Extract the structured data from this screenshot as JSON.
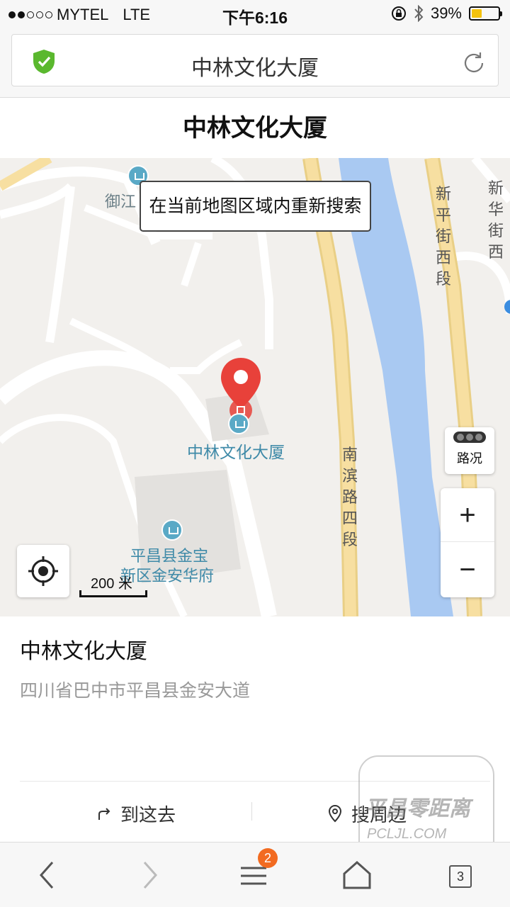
{
  "status": {
    "carrier": "MYTEL",
    "network": "LTE",
    "time": "下午6:16",
    "battery": "39%",
    "battery_level": 0.39
  },
  "browser": {
    "url_title": "中林文化大厦",
    "tab_count": "3",
    "menu_badge": "2"
  },
  "page": {
    "title": "中林文化大厦"
  },
  "map": {
    "research_button": "在当前地图区域内重新搜索",
    "poi_label": "中林文化大厦",
    "label_yujiang": "御江",
    "label_jinbao_1": "平昌县金宝",
    "label_jinbao_2": "新区金安华府",
    "road_nanbin": "南滨路四段",
    "road_xinping": "新平街西段",
    "road_xinhua": "新华街西",
    "traffic_label": "路况",
    "zoom_in": "+",
    "zoom_out": "−",
    "scale": "200 米"
  },
  "place": {
    "name": "中林文化大厦",
    "address": "四川省巴中市平昌县金安大道"
  },
  "actions": {
    "go_here": "到这去",
    "search_nearby": "搜周边"
  },
  "watermark": {
    "text_1": "平昌零距离",
    "text_2": "PCLJL.COM"
  },
  "colors": {
    "river": "#a9c9f2",
    "major_road": "#f7dfa1",
    "pin": "#e8413a",
    "badge": "#f26b21",
    "shield": "#5ab82e"
  }
}
